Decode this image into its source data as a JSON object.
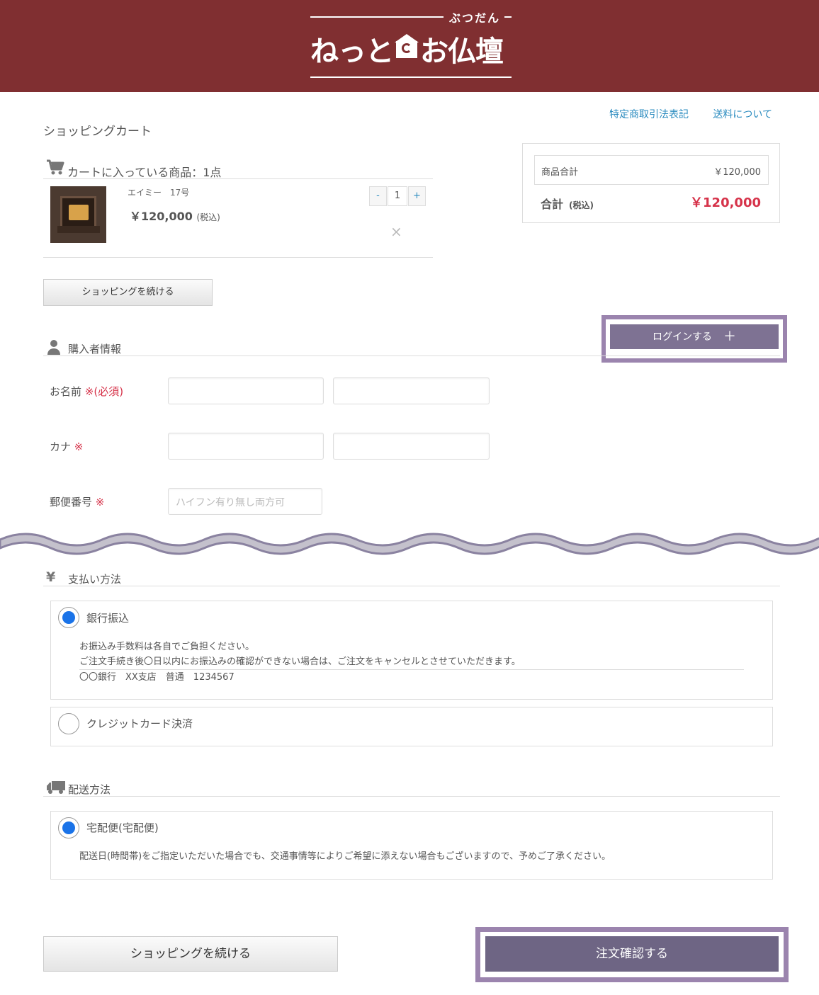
{
  "header": {
    "logo_ruby": "ぶつだん",
    "logo_text_left": "ねっと",
    "logo_text_right": "お仏壇"
  },
  "top_links": [
    "特定商取引法表記",
    "送料について"
  ],
  "page_title": "ショッピングカート",
  "cart": {
    "heading": "カートに入っている商品：1点",
    "item": {
      "name": "エイミー　17号",
      "price": "￥120,000",
      "price_note": "(税込)",
      "quantity": "1",
      "minus": "-",
      "plus": "+",
      "remove": "×"
    }
  },
  "summary": {
    "subtotal_label": "商品合計",
    "subtotal_value": "￥120,000",
    "total_label": "合計",
    "total_note": "(税込)",
    "total_value": "￥120,000"
  },
  "continue_shopping": "ショッピングを続ける",
  "login": {
    "label": "ログインする",
    "plus": "＋"
  },
  "buyer": {
    "heading": "購入者情報",
    "name_label": "お名前",
    "name_req": "※(必須)",
    "kana_label": "カナ",
    "kana_req": "※",
    "zip_label": "郵便番号",
    "zip_req": "※",
    "zip_placeholder": "ハイフン有り無し両方可"
  },
  "payment": {
    "heading": "支払い方法",
    "options": [
      {
        "label": "銀行振込",
        "selected": true,
        "notes": [
          "お振込み手数料は各自でご負担ください。",
          "ご注文手続き後〇日以内にお振込みの確認ができない場合は、ご注文をキャンセルとさせていただきます。",
          "〇〇銀行　XX支店　普通　1234567"
        ]
      },
      {
        "label": "クレジットカード決済",
        "selected": false
      }
    ]
  },
  "shipping": {
    "heading": "配送方法",
    "option_label": "宅配便(宅配便)",
    "note": "配送日(時間帯)をご指定いただいた場合でも、交通事情等によりご希望に添えない場合もございますので、予めご了承ください。"
  },
  "confirm_button": "注文確認する",
  "colors": {
    "header_bg": "#802f31",
    "link": "#2a8bbf",
    "price_accent": "#d6334a",
    "button_purple": "#6e6584",
    "highlight_frame": "#9b84ae",
    "radio_selected": "#1a73e8"
  }
}
